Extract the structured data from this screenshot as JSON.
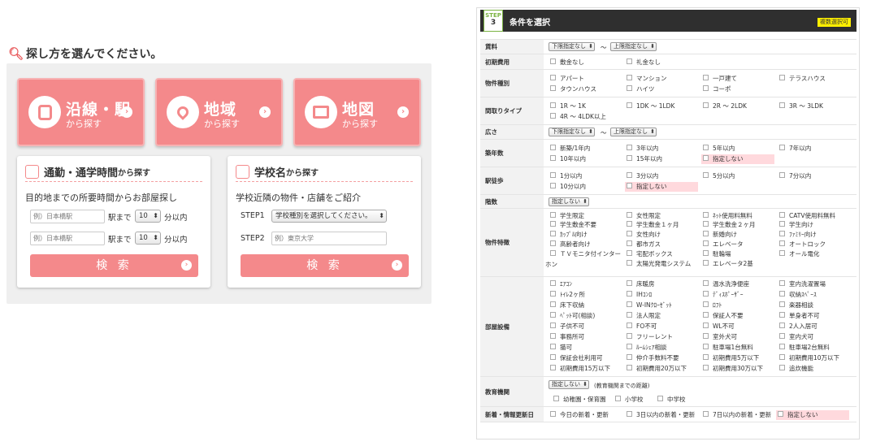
{
  "left": {
    "heading": "探し方を選んでください。",
    "btn_line": {
      "title": "沿線・駅",
      "sub": "から探す"
    },
    "btn_area": {
      "title": "地域",
      "sub": "から探す"
    },
    "btn_map": {
      "title": "地図",
      "sub": "から探す"
    },
    "commute": {
      "title": "通勤・通学時間",
      "title_small": "から探す",
      "desc": "目的地までの所要時間からお部屋探し",
      "station_placeholder": "例）日本橋駅",
      "station_placeholder2": "例）日本橋駅",
      "to_label": "駅まで",
      "to_label2": "駅まで",
      "minutes": "10",
      "minutes2": "10",
      "within": "分以内",
      "within2": "分以内",
      "search": "検 索"
    },
    "school": {
      "title": "学校名",
      "title_small": "から探す",
      "desc": "学校近隣の物件・店舗をご紹介",
      "step1": "STEP1",
      "step1_select": "学校種別を選択してください。",
      "step2": "STEP2",
      "step2_placeholder": "例）東京大学",
      "search": "検 索"
    }
  },
  "right": {
    "step_label": "STEP",
    "step_num": "3",
    "title": "条件を選択",
    "badge": "複数選択可",
    "rent": {
      "label": "賃料",
      "min": "下限指定なし",
      "max": "上限指定なし",
      "tilde": "〜"
    },
    "initial": {
      "label": "初期費用",
      "opts": [
        "敷金なし",
        "礼金なし"
      ]
    },
    "type": {
      "label": "物件種別",
      "opts": [
        "アパート",
        "マンション",
        "一戸建て",
        "テラスハウス",
        "タウンハウス",
        "ハイツ",
        "コーポ"
      ]
    },
    "layout": {
      "label": "間取りタイプ",
      "opts": [
        "1R 〜 1K",
        "1DK 〜 1LDK",
        "2R 〜 2LDK",
        "3R 〜 3LDK",
        "4R 〜 4LDK以上"
      ]
    },
    "area": {
      "label": "広さ",
      "min": "下限指定なし",
      "max": "上限指定なし",
      "tilde": "〜"
    },
    "age": {
      "label": "築年数",
      "opts": [
        "新築/1年内",
        "3年以内",
        "5年以内",
        "7年以内",
        "10年以内",
        "15年以内",
        "指定しない"
      ]
    },
    "walk": {
      "label": "駅徒歩",
      "opts": [
        "1分以内",
        "3分以内",
        "5分以内",
        "7分以内",
        "10分以内",
        "指定しない"
      ]
    },
    "floor": {
      "label": "階数",
      "sel": "指定しない"
    },
    "features": {
      "label": "物件特徴",
      "opts": [
        "学生限定",
        "女性限定",
        "ﾈｯﾄ使用料無料",
        "CATV使用料無料",
        "学生敷金不要",
        "学生敷金１ヶ月",
        "学生敷金２ヶ月",
        "学生向け",
        "ｶｯﾌﾟﾙ向け",
        "女性向け",
        "新婚向け",
        "ﾌｧﾐﾘｰ向け",
        "高齢者向け",
        "都市ガス",
        "エレベータ",
        "オートロック",
        "ＴＶモニタ付インター",
        "宅配ボックス",
        "駐輪場",
        "オール電化",
        "ホン",
        "太陽光発電システム",
        "エレベータ2基"
      ]
    },
    "facilities": {
      "label": "部屋設備",
      "opts": [
        "ｴｱｺﾝ",
        "床暖房",
        "温水洗浄便座",
        "室内洗濯置場",
        "ﾄｲﾚ2ヶ所",
        "IHｺﾝﾛ",
        "ﾃﾞｨｽﾎﾟｰｻﾞｰ",
        "収納ｽﾍﾟｰｽ",
        "床下収納",
        "W-INｸﾛｰｾﾞｯﾄ",
        "ﾛﾌﾄ",
        "楽器相談",
        "ﾍﾟｯﾄ可(相談)",
        "法人限定",
        "保証人不要",
        "単身者不可",
        "子供不可",
        "FO不可",
        "WL不可",
        "2人入居可",
        "事務所可",
        "フリーレント",
        "室外犬可",
        "室内犬可",
        "猫可",
        "ﾙｰﾑｼｪｱ相談",
        "駐車場1台無料",
        "駐車場2台無料",
        "保証会社利用可",
        "仲介手数料不要",
        "初期費用5万以下",
        "初期費用10万以下",
        "初期費用15万以下",
        "初期費用20万以下",
        "初期費用30万以下",
        "追炊機能"
      ]
    },
    "school": {
      "label": "教育機関",
      "sel": "指定しない",
      "note": "(教育機関までの距離)",
      "opts": [
        "幼稚園・保育園",
        "小学校",
        "中学校"
      ]
    },
    "updated": {
      "label": "新着・情報更新日",
      "opts": [
        "今日の新着・更新",
        "3日以内の新着・更新",
        "7日以内の新着・更新",
        "指定しない"
      ]
    }
  }
}
